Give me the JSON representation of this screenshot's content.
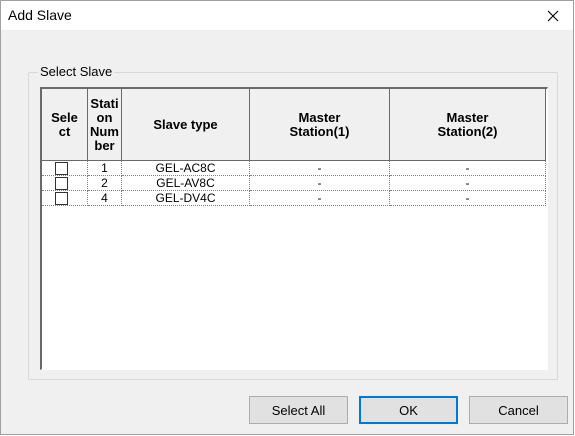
{
  "window": {
    "title": "Add Slave",
    "close_icon": "close-icon"
  },
  "group": {
    "legend": "Select Slave"
  },
  "grid": {
    "headers": [
      "Sele\nct",
      "Stati\non\nNum\nber",
      "Slave type",
      "Master\nStation(1)",
      "Master\nStation(2)"
    ],
    "rows": [
      {
        "selected": false,
        "station": "1",
        "slave_type": "GEL-AC8C",
        "master1": "-",
        "master2": "-"
      },
      {
        "selected": false,
        "station": "2",
        "slave_type": "GEL-AV8C",
        "master1": "-",
        "master2": "-"
      },
      {
        "selected": false,
        "station": "4",
        "slave_type": "GEL-DV4C",
        "master1": "-",
        "master2": "-"
      }
    ]
  },
  "buttons": {
    "select_all": "Select All",
    "ok": "OK",
    "cancel": "Cancel"
  }
}
